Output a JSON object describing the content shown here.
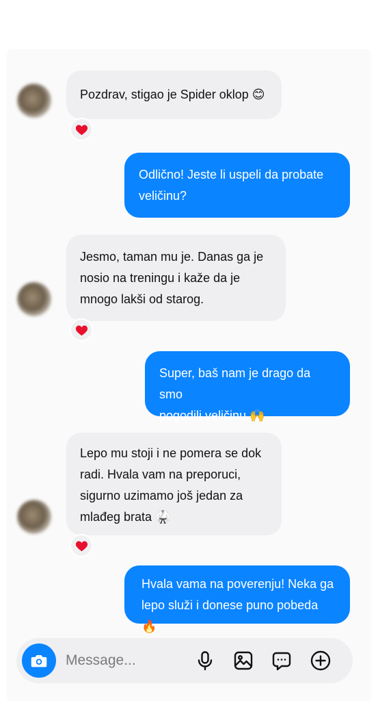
{
  "messages": [
    {
      "direction": "incoming",
      "text": "Pozdrav, stigao je Spider oklop 😊",
      "reaction": "heart"
    },
    {
      "direction": "outgoing",
      "text": "Odlično! Jeste li uspeli da probate\nveličinu?"
    },
    {
      "direction": "incoming",
      "text": "Jesmo, taman mu je. Danas ga je\nnosio na treningu i kaže da je\nmnogo lakši od starog.",
      "reaction": "heart"
    },
    {
      "direction": "outgoing",
      "text": "Super, baš nam je drago da smo\npogodili veličinu 🙌"
    },
    {
      "direction": "incoming",
      "text": "Lepo mu stoji i ne pomera se dok\nradi. Hvala vam na preporuci,\nsigurno uzimamo još jedan za\nmlađeg brata 🥋",
      "reaction": "heart"
    },
    {
      "direction": "outgoing",
      "text": "Hvala vama na poverenju! Neka ga\nlepo služi i donese puno pobeda 🔥"
    }
  ],
  "composer": {
    "placeholder": "Message...",
    "camera_icon": "camera-icon",
    "tools": [
      "microphone-icon",
      "image-icon",
      "sticker-chat-icon",
      "add-icon"
    ]
  },
  "colors": {
    "accent": "#0b84ff",
    "incoming_bubble": "#efeff1",
    "reaction": "#e8112d"
  }
}
